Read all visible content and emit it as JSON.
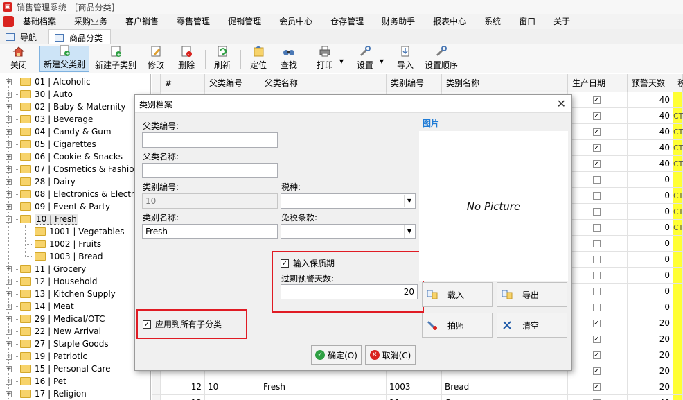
{
  "window": {
    "title": "销售管理系统 - [商品分类]"
  },
  "menu": [
    "基础档案",
    "采购业务",
    "客户销售",
    "零售管理",
    "促销管理",
    "会员中心",
    "仓存管理",
    "财务助手",
    "报表中心",
    "系统",
    "窗口",
    "关于"
  ],
  "tabs": [
    {
      "label": "导航"
    },
    {
      "label": "商品分类"
    }
  ],
  "toolbar": [
    {
      "label": "关闭",
      "icon": "home-icon"
    },
    {
      "label": "新建父类别",
      "icon": "new-parent-icon"
    },
    {
      "label": "新建子类别",
      "icon": "new-child-icon"
    },
    {
      "label": "修改",
      "icon": "edit-icon"
    },
    {
      "label": "删除",
      "icon": "delete-icon"
    },
    {
      "label": "刷新",
      "icon": "refresh-icon"
    },
    {
      "label": "定位",
      "icon": "locate-icon"
    },
    {
      "label": "查找",
      "icon": "find-icon"
    },
    {
      "label": "打印",
      "icon": "print-icon"
    },
    {
      "label": "设置",
      "icon": "wrench-icon"
    },
    {
      "label": "导入",
      "icon": "import-icon"
    },
    {
      "label": "设置顺序",
      "icon": "wrench-icon"
    }
  ],
  "tree": [
    {
      "label": "01 | Alcoholic",
      "expand": "+"
    },
    {
      "label": "30 | Auto",
      "expand": "+"
    },
    {
      "label": "02 | Baby & Maternity",
      "expand": "+"
    },
    {
      "label": "03 | Beverage",
      "expand": "+"
    },
    {
      "label": "04 | Candy & Gum",
      "expand": "+"
    },
    {
      "label": "05 | Cigarettes",
      "expand": "+"
    },
    {
      "label": "06 | Cookie & Snacks",
      "expand": "+"
    },
    {
      "label": "07 | Cosmetics & Fashion",
      "expand": "+"
    },
    {
      "label": "28 | Dairy",
      "expand": "+"
    },
    {
      "label": "08 | Electronics & Electrical",
      "expand": "+"
    },
    {
      "label": "09 | Event & Party",
      "expand": "+"
    },
    {
      "label": "10 | Fresh",
      "expand": "-",
      "selected": true
    },
    {
      "label": "1001 | Vegetables",
      "child": true
    },
    {
      "label": "1002 | Fruits",
      "child": true
    },
    {
      "label": "1003 | Bread",
      "child": true
    },
    {
      "label": "11 | Grocery",
      "expand": "+"
    },
    {
      "label": "12 | Household",
      "expand": "+"
    },
    {
      "label": "13 | Kitchen Supply",
      "expand": "+"
    },
    {
      "label": "14 | Meat",
      "expand": "+"
    },
    {
      "label": "29 | Medical/OTC",
      "expand": "+"
    },
    {
      "label": "22 | New Arrival",
      "expand": "+"
    },
    {
      "label": "27 | Staple Goods",
      "expand": "+"
    },
    {
      "label": "19 | Patriotic",
      "expand": "+"
    },
    {
      "label": "15 | Personal Care",
      "expand": "+"
    },
    {
      "label": "16 | Pet",
      "expand": "+"
    },
    {
      "label": "17 | Religion",
      "expand": "+"
    }
  ],
  "grid": {
    "headers": [
      "#",
      "父类编号",
      "父类名称",
      "类别编号",
      "类别名称",
      "生产日期",
      "预警天数",
      "税"
    ],
    "rows": [
      {
        "checked": true,
        "days": "40",
        "tax": ""
      },
      {
        "checked": true,
        "days": "40",
        "tax": "CT"
      },
      {
        "checked": true,
        "days": "40",
        "tax": "CT"
      },
      {
        "checked": true,
        "days": "40",
        "tax": "CT"
      },
      {
        "checked": true,
        "days": "40",
        "tax": "CT"
      },
      {
        "checked": false,
        "days": "0",
        "tax": ""
      },
      {
        "checked": false,
        "days": "0",
        "tax": "CT"
      },
      {
        "checked": false,
        "days": "0",
        "tax": "CT"
      },
      {
        "checked": false,
        "days": "0",
        "tax": "CT"
      },
      {
        "checked": false,
        "days": "0",
        "tax": ""
      },
      {
        "checked": false,
        "days": "0",
        "tax": ""
      },
      {
        "checked": false,
        "days": "0",
        "tax": ""
      },
      {
        "checked": false,
        "days": "0",
        "tax": ""
      },
      {
        "checked": false,
        "days": "0",
        "tax": ""
      },
      {
        "checked": true,
        "days": "20",
        "tax": ""
      },
      {
        "checked": true,
        "days": "20",
        "tax": ""
      },
      {
        "checked": true,
        "days": "20",
        "tax": ""
      },
      {
        "checked": true,
        "days": "20",
        "tax": ""
      },
      {
        "num": "12",
        "parent_no": "10",
        "parent_name": "Fresh",
        "cat_no": "1003",
        "cat_name": "Bread",
        "checked": true,
        "days": "20",
        "tax": ""
      },
      {
        "num": "13",
        "parent_no": "",
        "parent_name": "",
        "cat_no": "11",
        "cat_name": "Grocery",
        "checked": true,
        "days": "40",
        "tax": ""
      }
    ]
  },
  "dialog": {
    "title": "类别档案",
    "parent_no_label": "父类编号:",
    "parent_no_value": "",
    "parent_name_label": "父类名称:",
    "parent_name_value": "",
    "cat_no_label": "类别编号:",
    "cat_no_value": "10",
    "tax_label": "税种:",
    "tax_value": "",
    "cat_name_label": "类别名称:",
    "cat_name_value": "Fresh",
    "exempt_label": "免税条款:",
    "exempt_value": "",
    "shelf_life_label": "输入保质期",
    "shelf_life_checked": true,
    "warn_days_label": "过期预警天数:",
    "warn_days_value": "20",
    "apply_all_label": "应用到所有子分类",
    "apply_all_checked": true,
    "picture_title": "图片",
    "no_picture": "No Picture",
    "load_label": "载入",
    "export_label": "导出",
    "photo_label": "拍照",
    "clear_label": "清空",
    "ok_label": "确定(O)",
    "cancel_label": "取消(C)"
  },
  "colors": {
    "highlight": "#e01b24",
    "accent": "#1e7bd6",
    "yellow": "#ffff33"
  }
}
